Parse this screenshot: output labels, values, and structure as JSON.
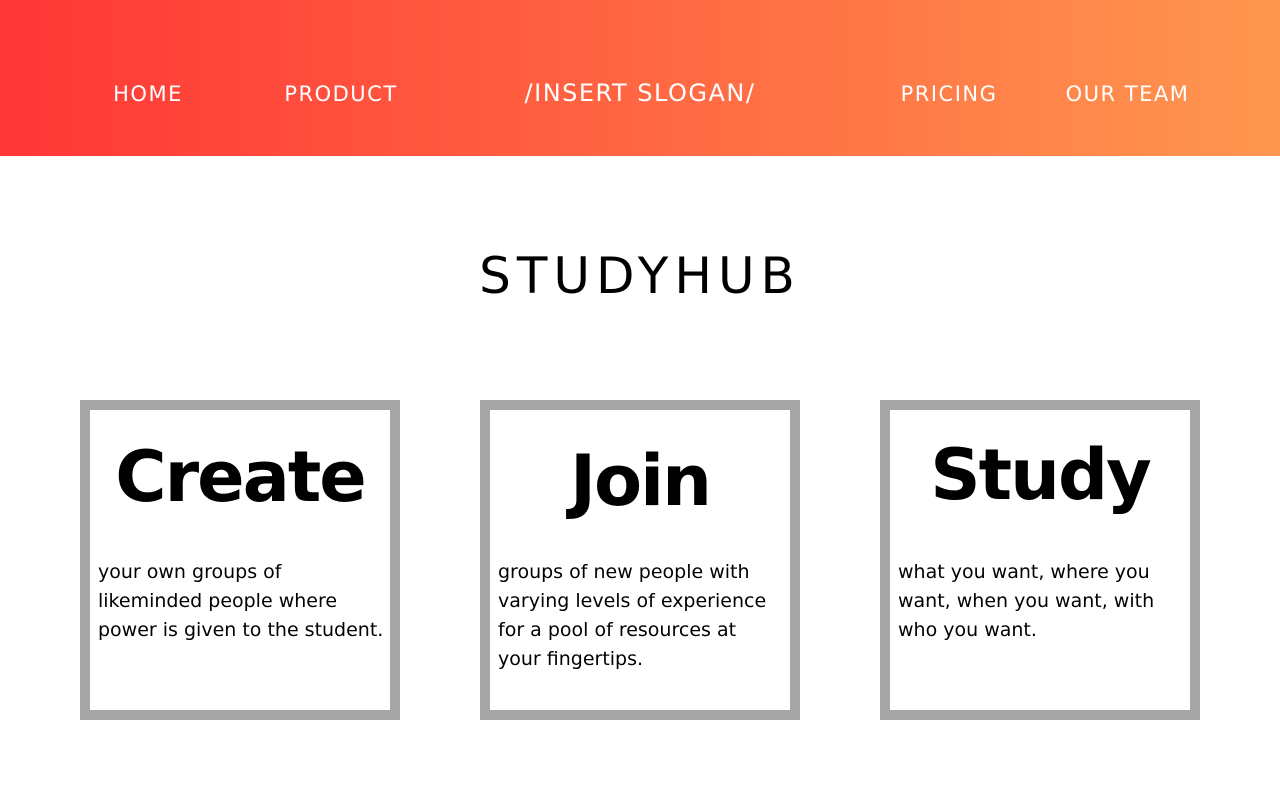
{
  "header": {
    "gradient_start": "#ff3636",
    "gradient_end": "#ff974f",
    "slogan": "/INSERT SLOGAN/",
    "nav": {
      "home": "HOME",
      "product": "PRODUCT",
      "pricing": "PRICING",
      "team": "OUR TEAM"
    }
  },
  "main": {
    "brand": "STUDYHUB",
    "cards": [
      {
        "heading": "Create",
        "body": "your own groups of likeminded people where power is given to the student."
      },
      {
        "heading": "Join",
        "body": "groups of new people with varying levels of experience for a pool of resources at your fingertips."
      },
      {
        "heading": "Study",
        "body": "what you want, where you want, when you want, with who you want."
      }
    ],
    "card_border_color": "#a6a6a6"
  }
}
